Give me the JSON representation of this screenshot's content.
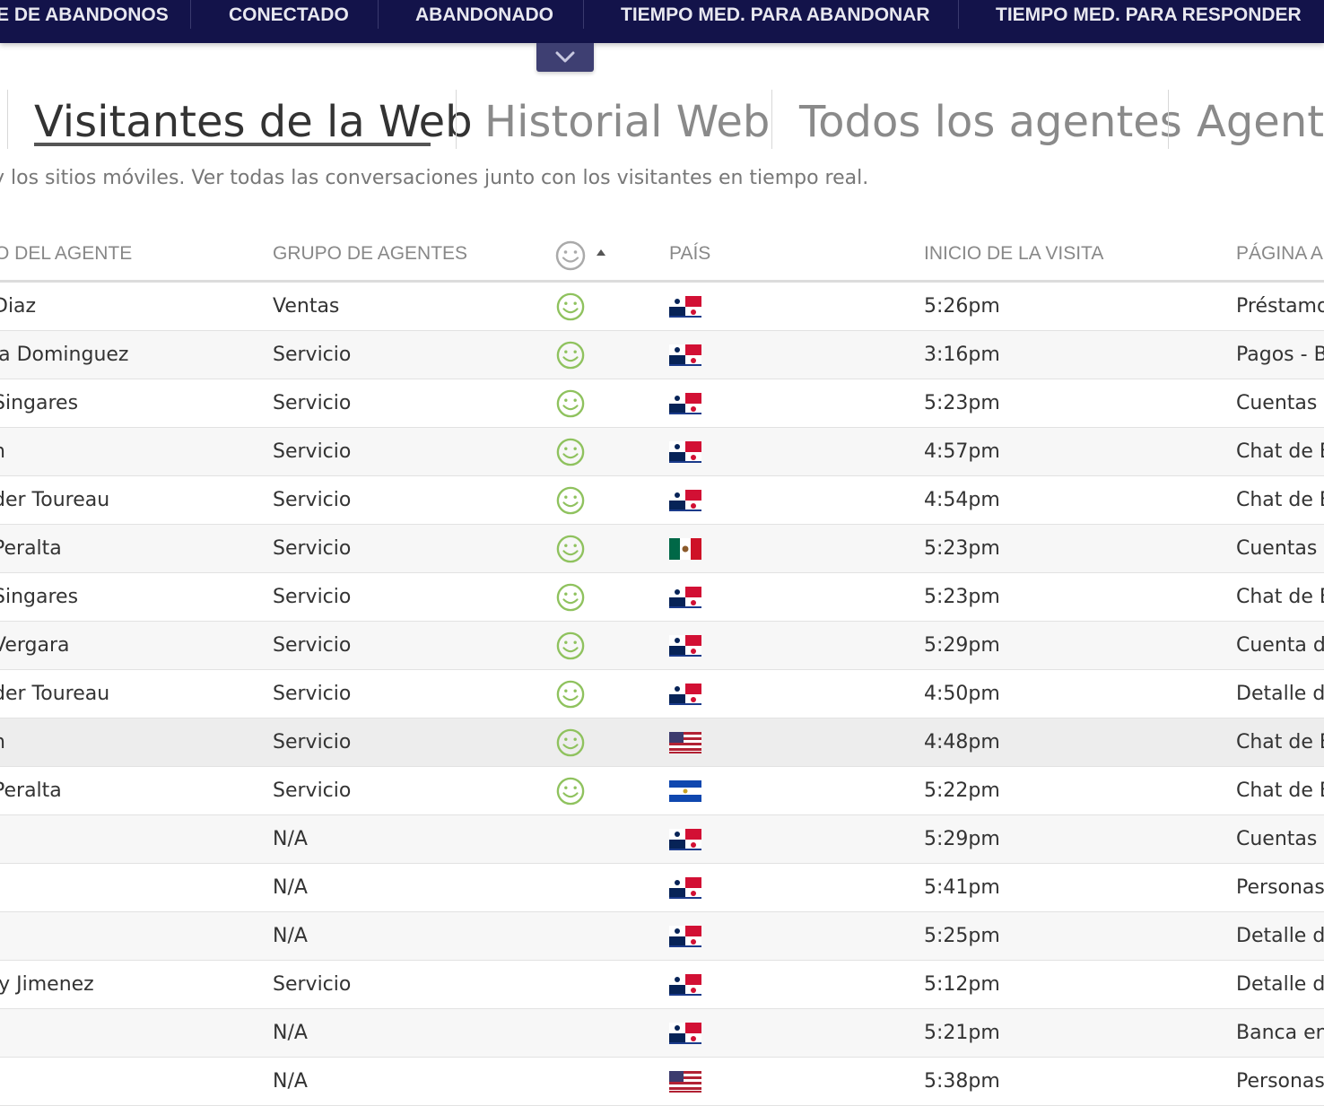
{
  "top_stats": {
    "items": [
      "E DE ABANDONOS",
      "CONECTADO",
      "ABANDONADO",
      "TIEMPO MED. PARA ABANDONAR",
      "TIEMPO MED. PARA RESPONDER"
    ],
    "bg_color": "#13134a"
  },
  "collapse_icon": "chevron-down-icon",
  "tabs": [
    {
      "label": "Visitantes de la Web",
      "active": true
    },
    {
      "label": "Historial Web",
      "active": false
    },
    {
      "label": "Todos los agentes",
      "active": false
    },
    {
      "label": "Agente",
      "active": false
    }
  ],
  "description": "y los sitios móviles. Ver todas las conversaciones junto con los visitantes en tiempo real.",
  "table": {
    "headers": {
      "agent": "O DEL AGENTE",
      "group": "GRUPO DE AGENTES",
      "satisfaction_icon": "smiley-icon",
      "sort_icon": "sort-up-icon",
      "country": "PAÍS",
      "visit_start": "INICIO DE LA VISITA",
      "page": "PÁGINA A"
    },
    "rows": [
      {
        "agent": "Diaz",
        "group": "Ventas",
        "smiley": true,
        "flag": "panama",
        "time": "5:26pm",
        "page": "Préstamo"
      },
      {
        "agent": "la Dominguez",
        "group": "Servicio",
        "smiley": true,
        "flag": "panama",
        "time": "3:16pm",
        "page": "Pagos - B"
      },
      {
        "agent": "Singares",
        "group": "Servicio",
        "smiley": true,
        "flag": "panama",
        "time": "5:23pm",
        "page": "Cuentas -"
      },
      {
        "agent": "h",
        "group": "Servicio",
        "smiley": true,
        "flag": "panama",
        "time": "4:57pm",
        "page": "Chat de B"
      },
      {
        "agent": "der Toureau",
        "group": "Servicio",
        "smiley": true,
        "flag": "panama",
        "time": "4:54pm",
        "page": "Chat de B"
      },
      {
        "agent": " Peralta",
        "group": "Servicio",
        "smiley": true,
        "flag": "mexico",
        "time": "5:23pm",
        "page": "Cuentas -"
      },
      {
        "agent": "Singares",
        "group": "Servicio",
        "smiley": true,
        "flag": "panama",
        "time": "5:23pm",
        "page": "Chat de B"
      },
      {
        "agent": " Vergara",
        "group": "Servicio",
        "smiley": true,
        "flag": "panama",
        "time": "5:29pm",
        "page": "Cuenta de"
      },
      {
        "agent": "der Toureau",
        "group": "Servicio",
        "smiley": true,
        "flag": "panama",
        "time": "4:50pm",
        "page": "Detalle d"
      },
      {
        "agent": "h",
        "group": "Servicio",
        "smiley": true,
        "flag": "usa",
        "time": "4:48pm",
        "page": "Chat de B"
      },
      {
        "agent": " Peralta",
        "group": "Servicio",
        "smiley": true,
        "flag": "el-salvador",
        "time": "5:22pm",
        "page": "Chat de B"
      },
      {
        "agent": "",
        "group": "N/A",
        "smiley": false,
        "flag": "panama",
        "time": "5:29pm",
        "page": "Cuentas -"
      },
      {
        "agent": "",
        "group": "N/A",
        "smiley": false,
        "flag": "panama",
        "time": "5:41pm",
        "page": "Personas"
      },
      {
        "agent": "",
        "group": "N/A",
        "smiley": false,
        "flag": "panama",
        "time": "5:25pm",
        "page": "Detalle d"
      },
      {
        "agent": "ly Jimenez",
        "group": "Servicio",
        "smiley": false,
        "flag": "panama",
        "time": "5:12pm",
        "page": "Detalle d"
      },
      {
        "agent": "",
        "group": "N/A",
        "smiley": false,
        "flag": "panama",
        "time": "5:21pm",
        "page": "Banca en"
      },
      {
        "agent": "",
        "group": "N/A",
        "smiley": false,
        "flag": "usa",
        "time": "5:38pm",
        "page": "Personas"
      }
    ]
  },
  "colors": {
    "smiley_green": "#8fc25e",
    "smiley_gray": "#999999"
  }
}
